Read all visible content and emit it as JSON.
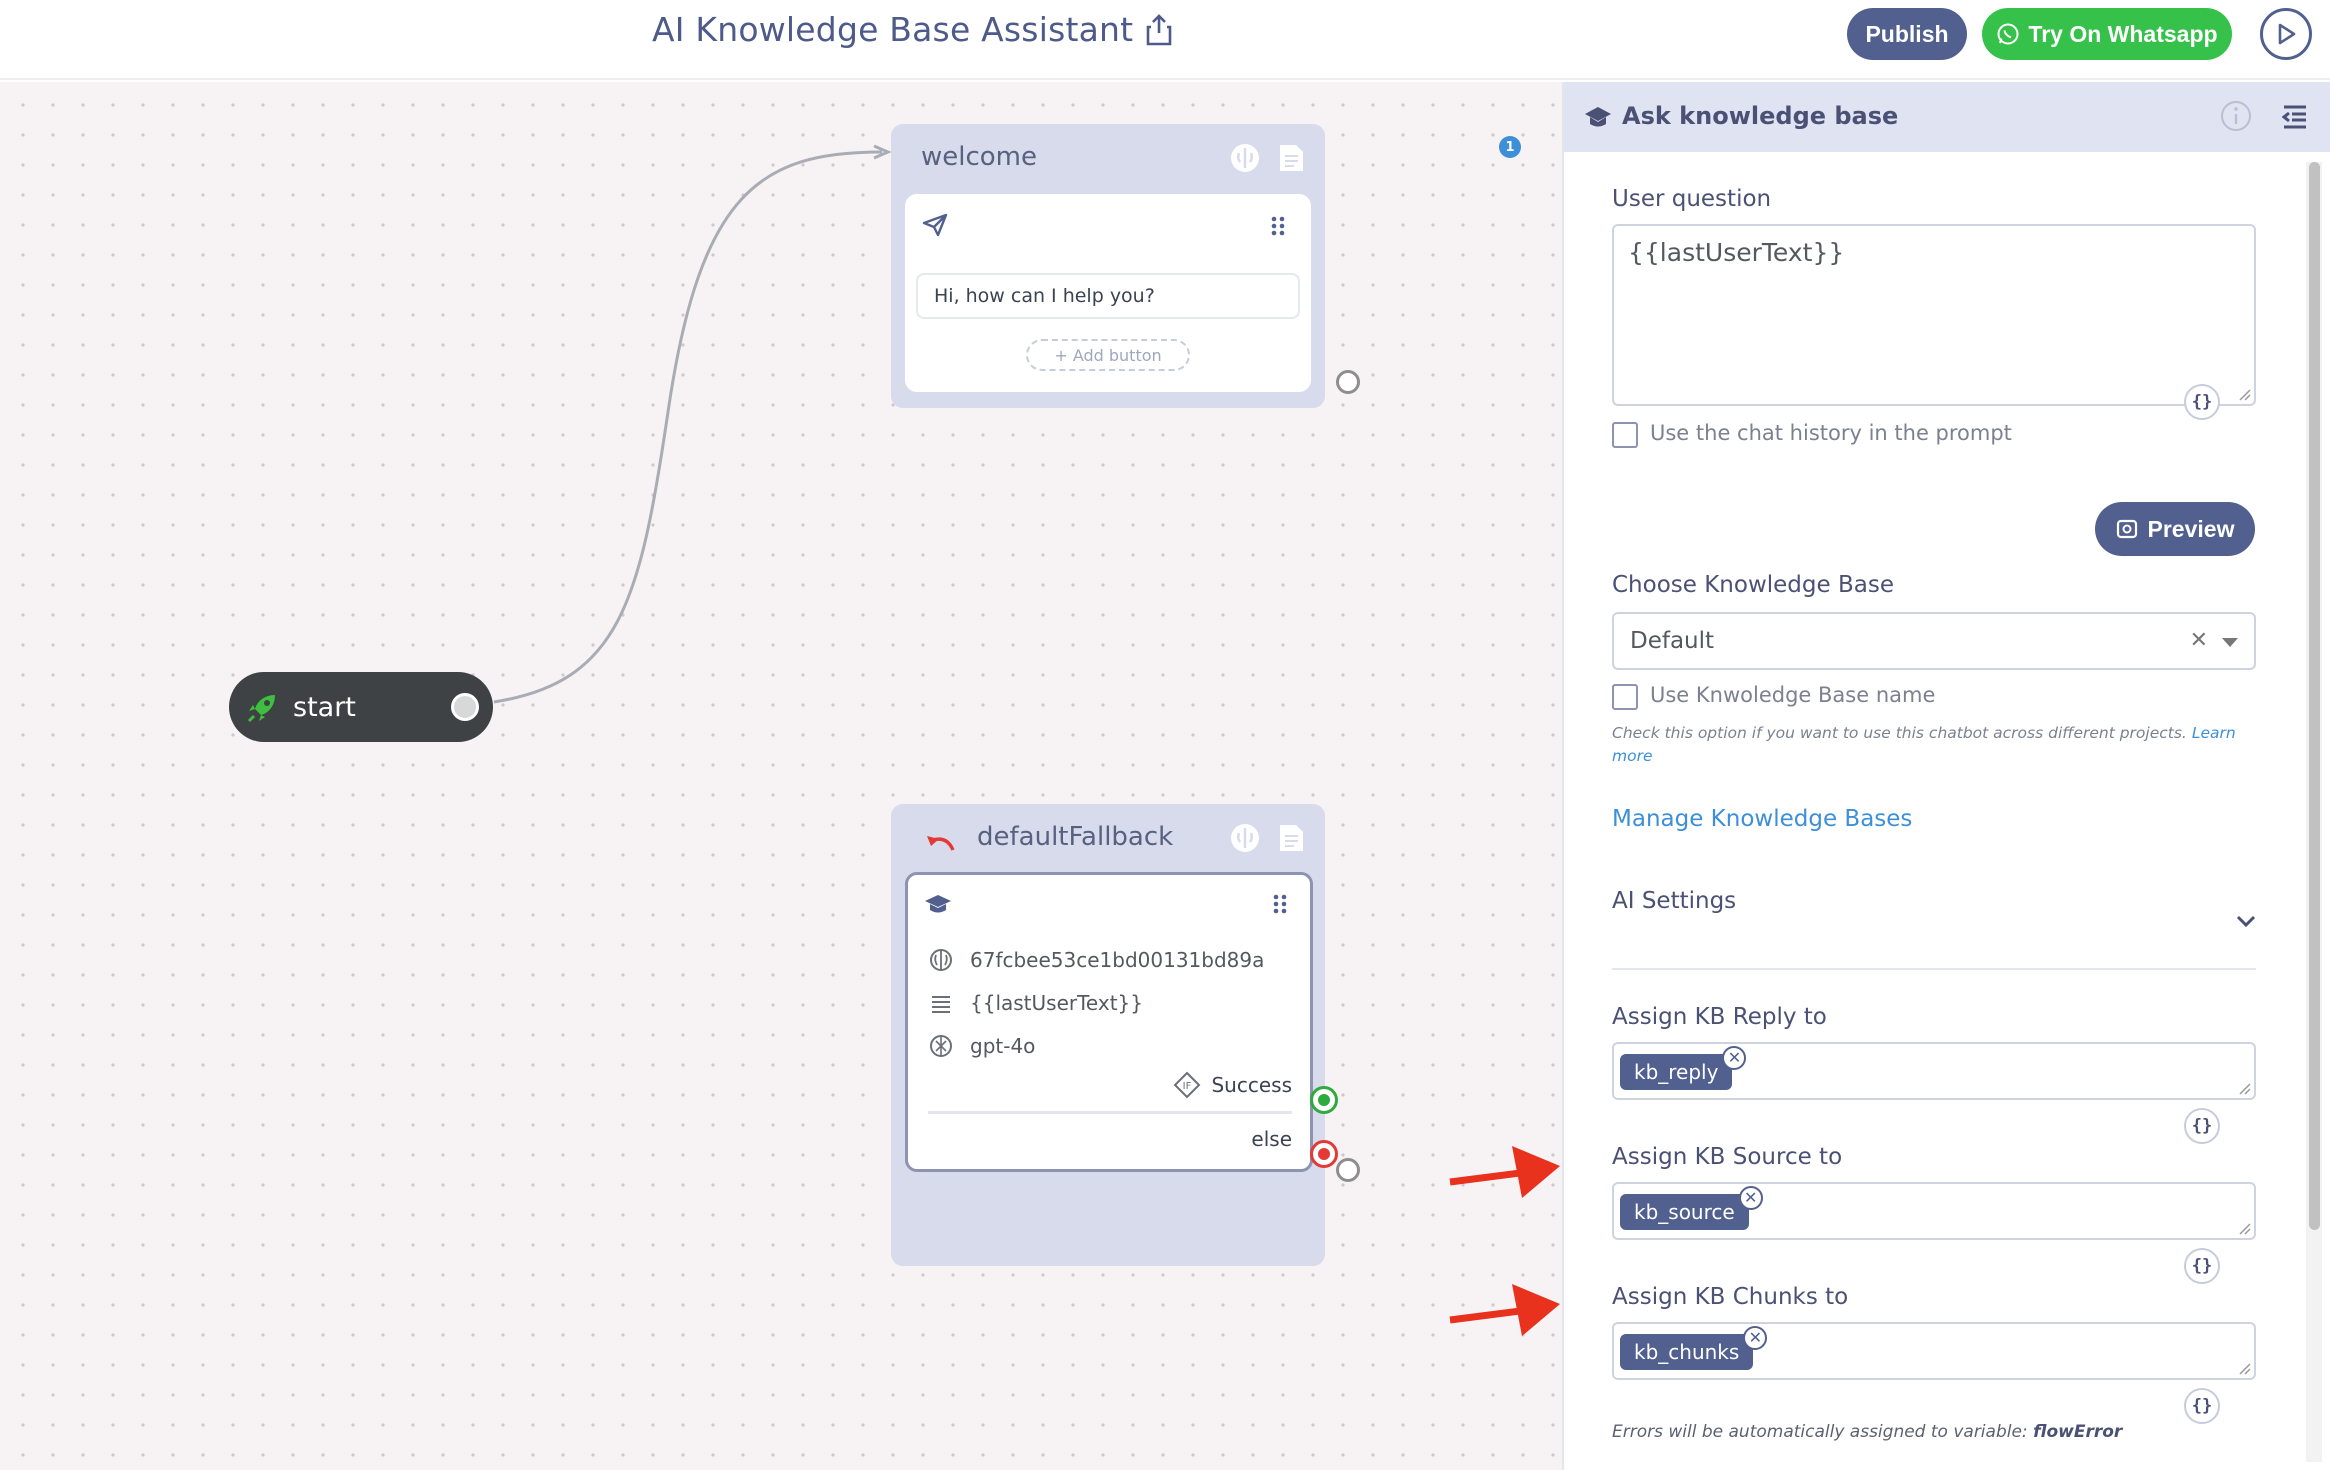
{
  "header": {
    "title": "AI Knowledge Base Assistant",
    "publish_label": "Publish",
    "whatsapp_label": "Try On Whatsapp"
  },
  "canvas": {
    "start": {
      "label": "start"
    },
    "welcome": {
      "title": "welcome",
      "message": "Hi, how can I help you?",
      "add_button": "+ Add button"
    },
    "fallback": {
      "title": "defaultFallback",
      "kb_id": "67fcbee53ce1bd00131bd89a",
      "question": "{{lastUserText}}",
      "model": "gpt-4o",
      "success_label": "Success",
      "else_label": "else"
    }
  },
  "panel": {
    "title": "Ask knowledge base",
    "user_question_label": "User question",
    "user_question_value": "{{lastUserText}}",
    "badge": "1",
    "chat_history_label": "Use the chat history in the prompt",
    "preview_label": "Preview",
    "choose_kb_label": "Choose Knowledge Base",
    "kb_selected": "Default",
    "use_kb_name_label": "Use Knwoledge Base name",
    "hint_text": "Check this option if you want to use this chatbot across different projects.",
    "hint_link": "Learn more",
    "manage_link": "Manage Knowledge Bases",
    "ai_settings_label": "AI Settings",
    "reply_label": "Assign KB Reply to",
    "reply_tag": "kb_reply",
    "source_label": "Assign KB Source to",
    "source_tag": "kb_source",
    "chunks_label": "Assign KB Chunks to",
    "chunks_tag": "kb_chunks",
    "errors_text": "Errors will be automatically assigned to variable:",
    "errors_var": "flowError"
  },
  "icons": {
    "share": "share-icon",
    "whatsapp": "whatsapp-icon",
    "play": "play-icon",
    "rocket": "rocket-icon",
    "brain": "brain-icon",
    "note": "note-icon",
    "send": "send-icon",
    "graduation": "graduation-cap-icon",
    "openai": "openai-icon",
    "lines": "text-lines-icon",
    "condition": "condition-icon",
    "undo": "undo-icon",
    "info": "info-icon",
    "collapse": "collapse-panel-icon",
    "chevron": "chevron-down-icon"
  },
  "colors": {
    "accent": "#52608f",
    "whatsapp": "#36c24a",
    "link": "#3c8fd8",
    "success": "#2eaa3f",
    "error": "#e53935",
    "arrow": "#e8321e"
  }
}
